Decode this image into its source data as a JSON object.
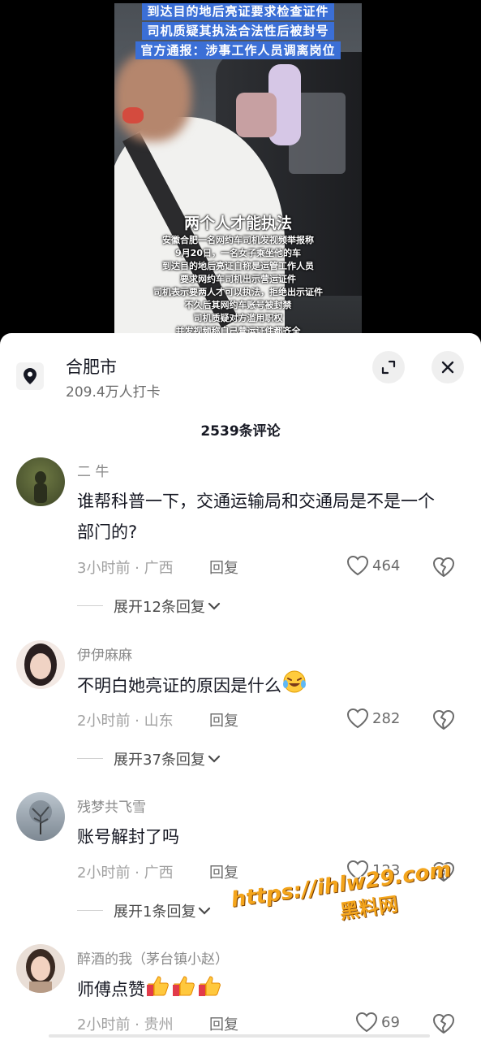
{
  "video": {
    "captions_top": [
      "到达目的地后亮证要求检查证件",
      "司机质疑其执法合法性后被封号",
      "官方通报：涉事工作人员调离岗位"
    ],
    "overlay_title": "两个人才能执法",
    "overlay_lines": [
      "安徽合肥一名网约车司机发视频举报称",
      "9月20日，一名女子乘坐他的车",
      "到达目的地后亮证自称是运管工作人员",
      "要求网约车司机出示营运证件",
      "司机表示要两人才可以执法，拒绝出示证件",
      "不久后其网约车账号被封禁",
      "司机质疑对方滥用职权",
      "并发视频称自己营运证件都齐全"
    ]
  },
  "location": {
    "title": "合肥市",
    "subtitle": "209.4万人打卡",
    "icon": "location-pin-icon"
  },
  "comments_count": "2539条评论",
  "comments": [
    {
      "user": "二 牛",
      "text": "谁帮科普一下，交通运输局和交通局是不是一个部门的?",
      "time": "3小时前 · 广西",
      "reply": "回复",
      "likes": "464",
      "expand": "展开12条回复"
    },
    {
      "user": "伊伊麻麻",
      "text": "不明白她亮证的原因是什么",
      "time": "2小时前 · 山东",
      "reply": "回复",
      "likes": "282",
      "expand": "展开37条回复"
    },
    {
      "user": "残梦共飞雪",
      "text": "账号解封了吗",
      "time": "2小时前 · 广西",
      "reply": "回复",
      "likes": "123",
      "expand": "展开1条回复"
    },
    {
      "user": "醉酒的我（茅台镇小赵）",
      "text": "师傅点赞",
      "time": "2小时前 · 贵州",
      "reply": "回复",
      "likes": "69"
    }
  ],
  "watermark": {
    "url": "https://ihlw29.com",
    "label": "黑料网"
  },
  "colors": {
    "caption_bg": "#3b6fd6",
    "watermark": "#f4a51c",
    "text_primary": "#161823"
  }
}
